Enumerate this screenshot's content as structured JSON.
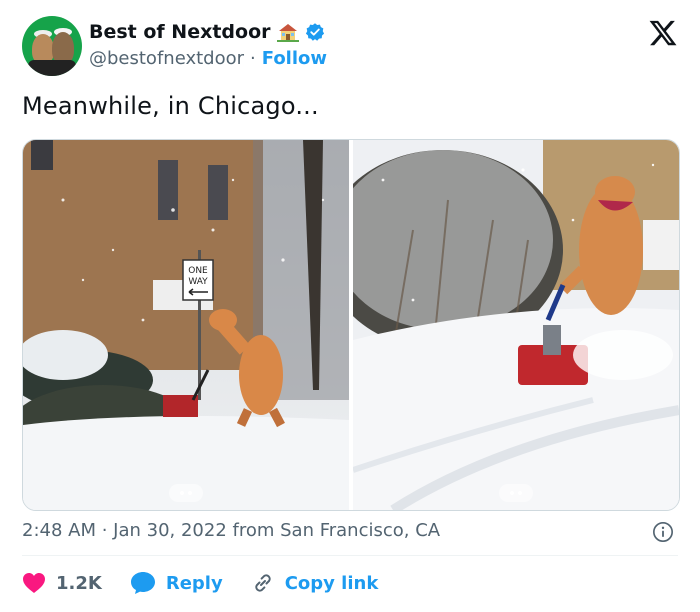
{
  "author": {
    "display_name": "Best of Nextdoor",
    "handle": "@bestofnextdoor",
    "separator": "·",
    "follow_label": "Follow"
  },
  "tweet": {
    "text": "Meanwhile, in Chicago..."
  },
  "media": {
    "count": 2,
    "photos": [
      {
        "sign_text_1": "ONE",
        "sign_text_2": "WAY"
      },
      {}
    ]
  },
  "meta": {
    "timestamp": "2:48 AM · Jan 30, 2022 from San Francisco, CA"
  },
  "actions": {
    "like_count": "1.2K",
    "reply_label": "Reply",
    "copy_link_label": "Copy link"
  },
  "colors": {
    "accent": "#1d9bf0",
    "like": "#f91880",
    "text": "#0f1419",
    "muted": "#536471",
    "verified": "#1d9bf0"
  },
  "icons": [
    "house-icon",
    "verified-icon",
    "x-logo-icon",
    "info-icon",
    "heart-icon",
    "reply-bubble-icon",
    "link-icon"
  ]
}
